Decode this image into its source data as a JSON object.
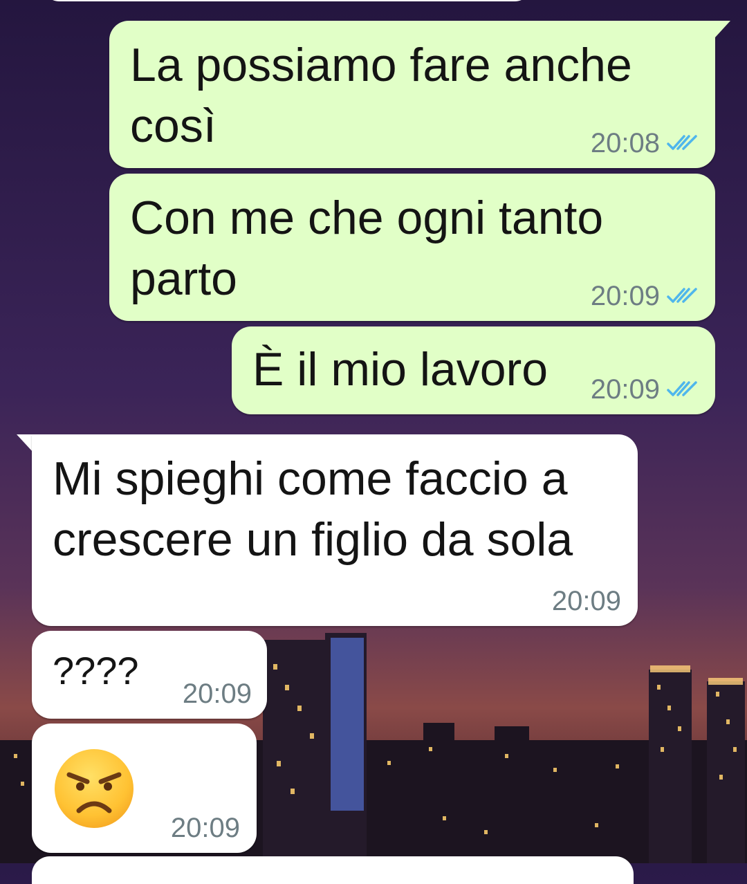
{
  "messages": [
    {
      "direction": "outgoing",
      "text_line1": "La possiamo fare anche",
      "text_line2": "così",
      "time": "20:08",
      "status": "read",
      "tick_icon": "double-check-icon"
    },
    {
      "direction": "outgoing",
      "text_line1": "Con me che ogni tanto",
      "text_line2": "parto",
      "time": "20:09",
      "status": "read",
      "tick_icon": "double-check-icon"
    },
    {
      "direction": "outgoing",
      "text_line1": "È il mio lavoro",
      "time": "20:09",
      "status": "read",
      "tick_icon": "double-check-icon"
    },
    {
      "direction": "incoming",
      "text_line1": "Mi spieghi come faccio a",
      "text_line2": "crescere un figlio da sola",
      "time": "20:09"
    },
    {
      "direction": "incoming",
      "text_line1": "????",
      "time": "20:09"
    },
    {
      "direction": "incoming",
      "emoji": "angry-face-emoji",
      "time": "20:09"
    }
  ],
  "colors": {
    "outgoing_bubble": "#e1ffc7",
    "incoming_bubble": "#ffffff",
    "read_ticks": "#4fb6ec",
    "timestamp": "#6d7d83"
  }
}
